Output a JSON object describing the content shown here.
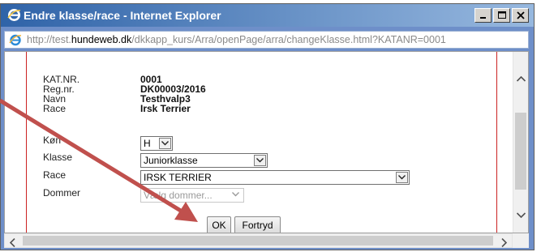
{
  "window": {
    "title": "Endre klasse/race - Internet Explorer",
    "address_prefix": "http://test.",
    "address_host": "hundeweb.dk",
    "address_path": "/dkkapp_kurs/Arra/openPage/arra/changeKlasse.html?KATANR=0001"
  },
  "details": {
    "katnr_label": "KAT.NR.",
    "katnr_value": "0001",
    "regnr_label": "Reg.nr.",
    "regnr_value": "DK00003/2016",
    "navn_label": "Navn",
    "navn_value": "Testhvalp3",
    "race_label": "Race",
    "race_value": "Irsk Terrier"
  },
  "form": {
    "kon_label": "Køn",
    "kon_value": "H",
    "klasse_label": "Klasse",
    "klasse_value": "Juniorklasse",
    "race_label": "Race",
    "race_value": "IRSK TERRIER",
    "dommer_label": "Dommer",
    "dommer_placeholder": "Vælg dommer..."
  },
  "buttons": {
    "ok": "OK",
    "cancel": "Fortryd"
  },
  "colors": {
    "titlebar_start": "#2f63a8",
    "titlebar_end": "#97b8df",
    "annotation_arrow": "#c0504d",
    "content_border": "#cc2222"
  },
  "icons": {
    "title": "ie-icon",
    "address": "ie-icon",
    "minimize": "minimize-icon",
    "maximize": "maximize-icon",
    "close": "close-icon"
  }
}
